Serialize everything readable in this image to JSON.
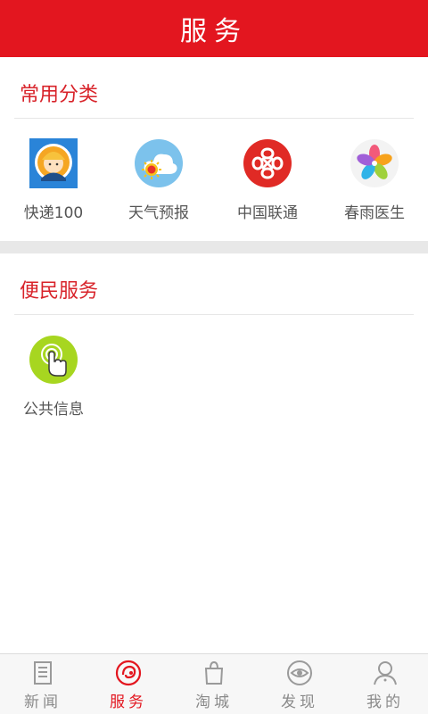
{
  "header": {
    "title": "服务"
  },
  "sections": [
    {
      "title": "常用分类",
      "items": [
        {
          "label": "快递100",
          "icon": "courier-person-icon"
        },
        {
          "label": "天气预报",
          "icon": "weather-sun-cloud-icon"
        },
        {
          "label": "中国联通",
          "icon": "china-unicom-logo-icon"
        },
        {
          "label": "春雨医生",
          "icon": "chunyu-flower-icon"
        }
      ]
    },
    {
      "title": "便民服务",
      "items": [
        {
          "label": "公共信息",
          "icon": "tap-finger-icon"
        }
      ]
    }
  ],
  "tabbar": {
    "active": "服务",
    "tabs": [
      {
        "label": "新闻",
        "icon": "newspaper-icon"
      },
      {
        "label": "服务",
        "icon": "service-swirl-icon"
      },
      {
        "label": "淘城",
        "icon": "shopping-bag-icon"
      },
      {
        "label": "发现",
        "icon": "eye-icon"
      },
      {
        "label": "我的",
        "icon": "user-icon"
      }
    ]
  },
  "colors": {
    "brand": "#e3161f",
    "section_title": "#d8232a",
    "tab_inactive": "#8a8a8a"
  }
}
